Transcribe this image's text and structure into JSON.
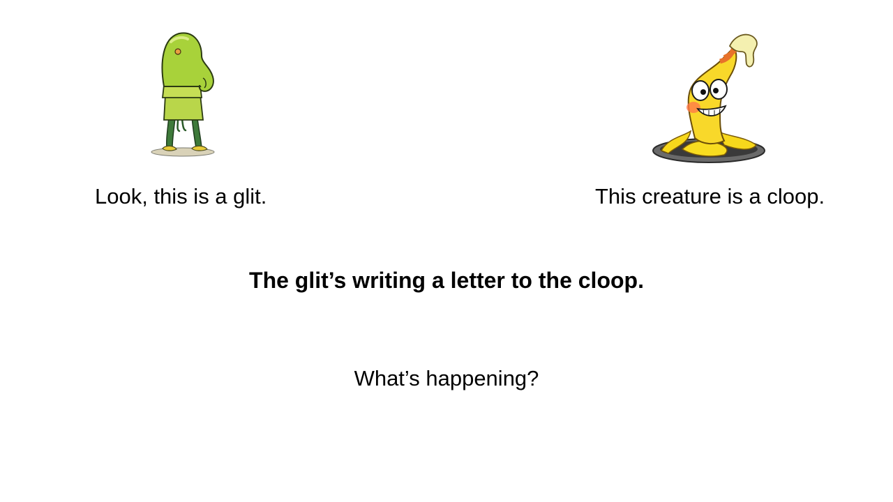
{
  "slide": {
    "left_caption": "Look, this is a glit.",
    "right_caption": "This creature is a cloop.",
    "headline": "The glit’s writing a letter to the cloop.",
    "question": "What’s happening?"
  },
  "illustrations": {
    "left": {
      "icon": "glit-creature-illustration",
      "main_color": "#b7d634"
    },
    "right": {
      "icon": "cloop-creature-illustration",
      "main_color": "#f6d41e",
      "stripe_color": "#e8722a"
    }
  },
  "colors": {
    "background": "#ffffff",
    "text": "#000000"
  }
}
